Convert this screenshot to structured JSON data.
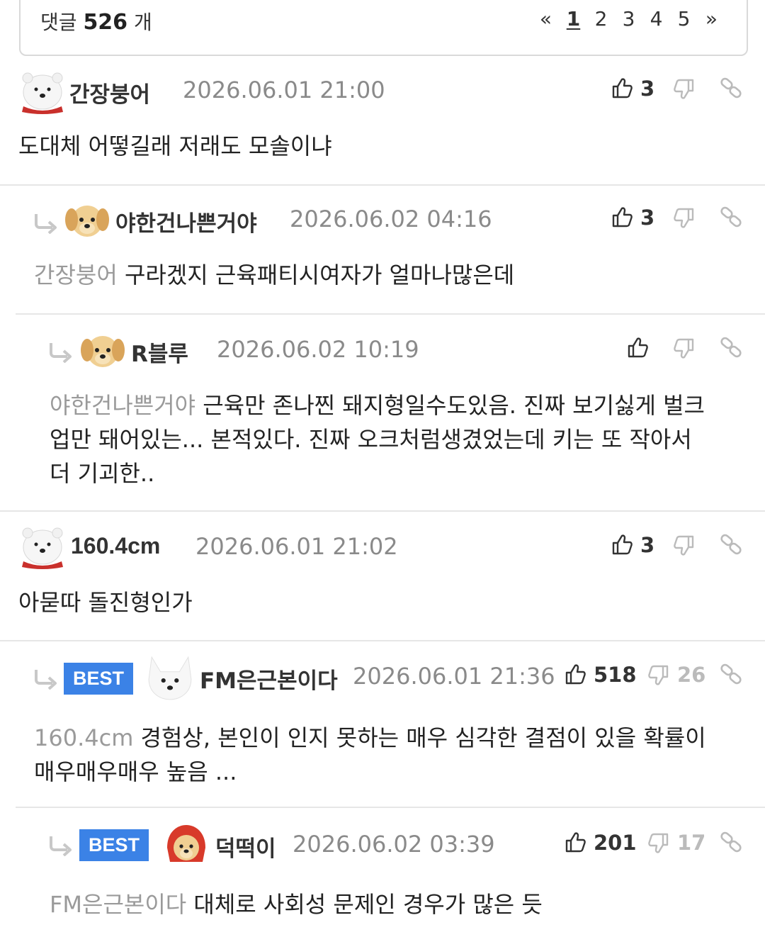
{
  "header": {
    "count_prefix": "댓글",
    "count": "526",
    "count_suffix": "개",
    "pager": [
      "«",
      "1",
      "2",
      "3",
      "4",
      "5",
      "»"
    ]
  },
  "comments": [
    {
      "nick": "간장붕어",
      "time": "2026.06.01 21:00",
      "likes": "3",
      "dislikes": "",
      "mention": "",
      "text": "도대체 어떻길래 저래도 모솔이냐",
      "best": ""
    },
    {
      "nick": "야한건나쁜거야",
      "time": "2026.06.02 04:16",
      "likes": "3",
      "dislikes": "",
      "mention": "간장붕어",
      "text": "구라겠지 근육패티시여자가 얼마나많은데",
      "best": ""
    },
    {
      "nick": "R블루",
      "time": "2026.06.02 10:19",
      "likes": "",
      "dislikes": "",
      "mention": "야한건나쁜거야",
      "text_lines": [
        "근육만 존나찐 돼지형일수도있음. 진짜 보기싫게 벌크",
        "업만 돼어있는... 본적있다. 진짜 오크처럼생겼었는데 키는 또 작아서",
        "더 기괴한.."
      ],
      "best": ""
    },
    {
      "nick": "160.4cm",
      "time": "2026.06.01 21:02",
      "likes": "3",
      "dislikes": "",
      "mention": "",
      "text": "아묻따 돌진형인가",
      "best": ""
    },
    {
      "nick": "FM은근본이다",
      "time": "2026.06.01 21:36",
      "likes": "518",
      "dislikes": "26",
      "mention": "160.4cm",
      "text_lines": [
        "경험상, 본인이 인지 못하는 매우 심각한 결점이 있을 확률이",
        "매우매우매우 높음 ..."
      ],
      "best": "BEST"
    },
    {
      "nick": "덕떡이",
      "time": "2026.06.02 03:39",
      "likes": "201",
      "dislikes": "17",
      "mention": "FM은근본이다",
      "text": "대체로 사회성 문제인 경우가 많은 듯",
      "best": "BEST"
    }
  ]
}
